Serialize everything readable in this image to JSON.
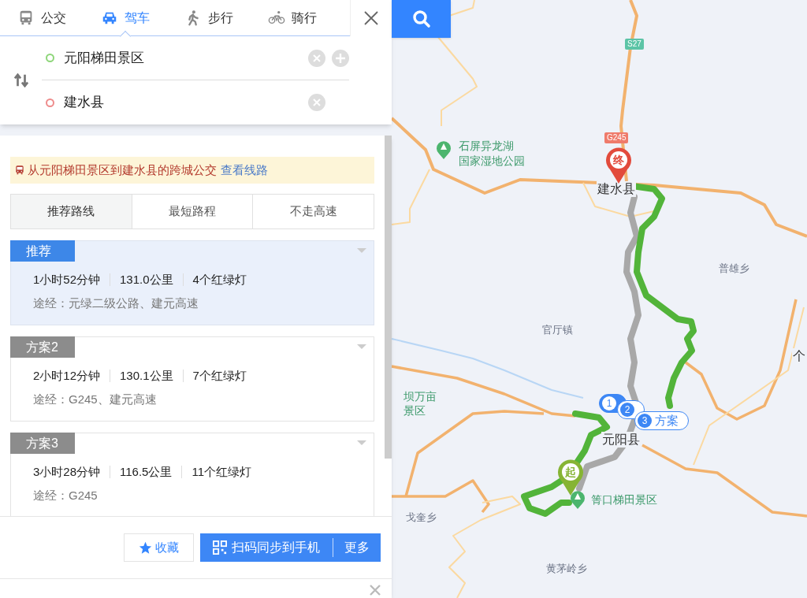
{
  "mode_tabs": [
    {
      "label": "公交",
      "kind": "bus",
      "selected": false
    },
    {
      "label": "驾车",
      "kind": "car",
      "selected": true
    },
    {
      "label": "步行",
      "kind": "walk",
      "selected": false
    },
    {
      "label": "骑行",
      "kind": "bike",
      "selected": false
    }
  ],
  "origin": {
    "value": "元阳梯田景区"
  },
  "destination": {
    "value": "建水县"
  },
  "bus_notice": {
    "text": "从元阳梯田景区到建水县的跨城公交",
    "link": "查看线路"
  },
  "route_filters": [
    {
      "label": "推荐路线",
      "selected": true
    },
    {
      "label": "最短路程",
      "selected": false
    },
    {
      "label": "不走高速",
      "selected": false
    }
  ],
  "routes": [
    {
      "tag": "推荐",
      "selected": true,
      "duration": "1小时52分钟",
      "distance": "131.0公里",
      "lights": "4个红绿灯",
      "via": "途经：元绿二级公路、建元高速"
    },
    {
      "tag": "方案2",
      "selected": false,
      "duration": "2小时12分钟",
      "distance": "130.1公里",
      "lights": "7个红绿灯",
      "via": "途经：G245、建元高速"
    },
    {
      "tag": "方案3",
      "selected": false,
      "duration": "3小时28分钟",
      "distance": "116.5公里",
      "lights": "11个红绿灯",
      "via": "途经：G245"
    }
  ],
  "actions": {
    "favorite": "收藏",
    "sync": "扫码同步到手机",
    "more": "更多"
  },
  "map": {
    "shields": [
      {
        "label": "S27",
        "color": "#5cc4a6"
      },
      {
        "label": "G245",
        "color": "#ef7b6b"
      }
    ],
    "places": [
      {
        "text": "石屏异龙湖",
        "kind": "poi"
      },
      {
        "text": "国家湿地公园",
        "kind": "poi"
      },
      {
        "text": "建水县",
        "kind": "city"
      },
      {
        "text": "普雄乡",
        "kind": "town"
      },
      {
        "text": "官厅镇",
        "kind": "town"
      },
      {
        "text": "个",
        "kind": "city"
      },
      {
        "text": "坝万亩",
        "kind": "poi"
      },
      {
        "text": "景区",
        "kind": "poi"
      },
      {
        "text": "元阳县",
        "kind": "city"
      },
      {
        "text": "箐口梯田景区",
        "kind": "poi"
      },
      {
        "text": "戈奎乡",
        "kind": "town"
      },
      {
        "text": "黄茅岭乡",
        "kind": "town"
      }
    ],
    "end_marker": "终",
    "start_marker": "起",
    "route_bubbles": [
      {
        "number": "1"
      },
      {
        "number": "2"
      },
      {
        "number": "3",
        "label": "方案"
      }
    ]
  }
}
